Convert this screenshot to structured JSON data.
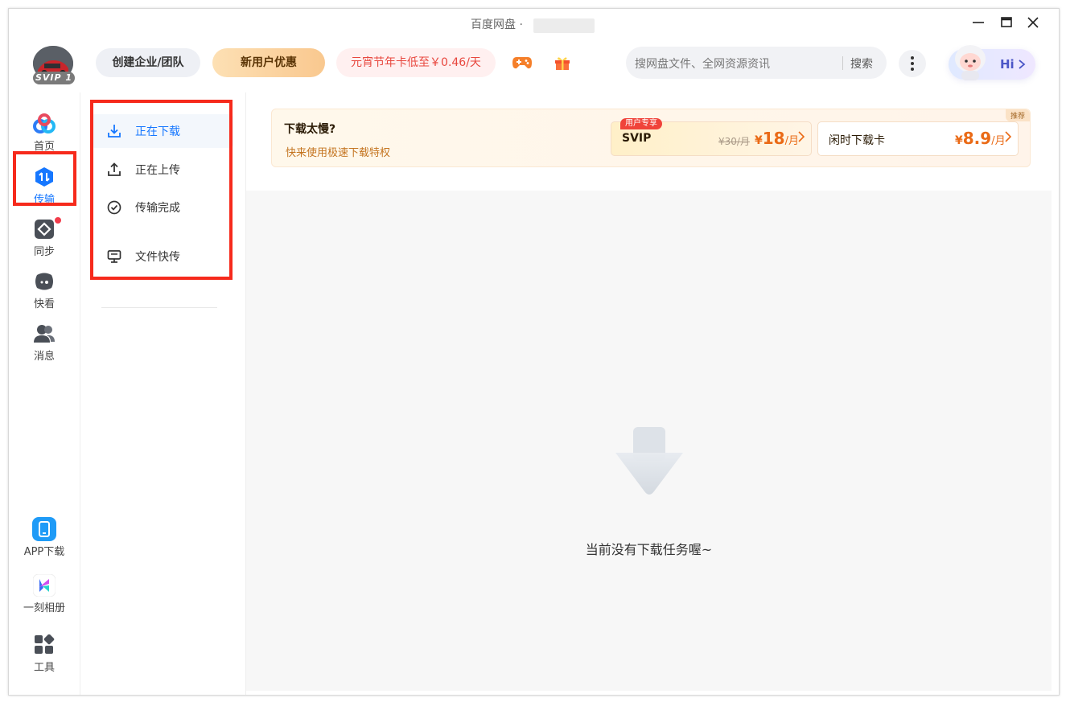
{
  "window": {
    "title": "百度网盘 ·",
    "minimize_icon": "minimize-icon",
    "maximize_icon": "maximize-icon",
    "close_icon": "close-icon"
  },
  "header": {
    "avatar_badge": "SVIP 1",
    "create_team": "创建企业/团队",
    "new_user_offer": "新用户优惠",
    "promo": "元宵节年卡低至￥0.46/天",
    "game_icon": "gamepad-icon",
    "gift_icon": "gift-icon",
    "search_placeholder": "搜网盘文件、全网资源资讯",
    "search_button": "搜索",
    "more_icon": "more-vertical-icon",
    "hi_label": "Hi"
  },
  "leftnav": {
    "items": [
      {
        "label": "首页",
        "icon": "home-icon"
      },
      {
        "label": "传输",
        "icon": "transfer-icon",
        "active": true
      },
      {
        "label": "同步",
        "icon": "sync-icon",
        "badge": true
      },
      {
        "label": "快看",
        "icon": "quick-view-icon"
      },
      {
        "label": "消息",
        "icon": "message-icon"
      }
    ],
    "bottom_items": [
      {
        "label": "APP下载",
        "icon": "phone-icon"
      },
      {
        "label": "一刻相册",
        "icon": "album-icon"
      },
      {
        "label": "工具",
        "icon": "tools-icon"
      }
    ]
  },
  "subnav": {
    "items": [
      {
        "label": "正在下载",
        "icon": "download-icon",
        "active": true
      },
      {
        "label": "正在上传",
        "icon": "upload-icon"
      },
      {
        "label": "传输完成",
        "icon": "check-circle-icon"
      },
      {
        "label": "文件快传",
        "icon": "monitor-icon"
      }
    ]
  },
  "banner": {
    "title": "下载太慢?",
    "subtitle": "快来使用极速下载特权",
    "recommend_tag": "推荐",
    "svip_card": {
      "badge": "用户专享",
      "name": "SVIP",
      "old_price": "¥30/月",
      "currency": "¥",
      "price": "18",
      "unit": "/月"
    },
    "idle_card": {
      "name": "闲时下载卡",
      "currency": "¥",
      "price": "8.9",
      "unit": "/月"
    }
  },
  "empty": {
    "message": "当前没有下载任务喔~",
    "icon": "download-arrow-icon"
  },
  "colors": {
    "accent": "#1677ff",
    "highlight_box": "#f62a1c",
    "price_orange": "#ea6a16",
    "promo_red": "#e8473e"
  }
}
